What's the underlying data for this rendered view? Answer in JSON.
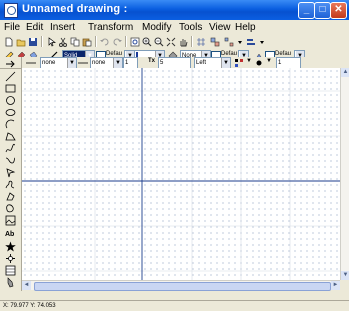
{
  "window": {
    "title": "Unnamed drawing :"
  },
  "title_buttons": {
    "minimize": "_",
    "maximize": "□",
    "close": "✕"
  },
  "menu": [
    "File",
    "Edit",
    "Insert",
    "Transform",
    "Modify",
    "Tools",
    "View",
    "Help"
  ],
  "toolbar2": {
    "line_style_value": "Solid",
    "checkbox1_label": "Defau",
    "checkbox2_label": "Defau",
    "fill_value": "None",
    "checkbox3_label": "Defau",
    "checkbox4_label": "Defau"
  },
  "toolbar3": {
    "arrow_start_value": "none",
    "arrow_end_value": "none",
    "width_value": "1",
    "font_size_value": "5",
    "align_value": "Left",
    "marker_value": "1"
  },
  "status": {
    "coords": "X: 79.977 Y: 74.053"
  },
  "scroll": {
    "up": "▲",
    "down": "▼",
    "left": "◄",
    "right": "►"
  },
  "icons": {
    "palette": [
      "select-arrow-icon",
      "line-tool-icon",
      "rectangle-tool-icon",
      "circle-tool-icon",
      "ellipse-tool-icon",
      "arc-tool-icon",
      "polygon-tool-icon",
      "freehand-tool-icon",
      "curve-tool-icon",
      "star-tool-icon",
      "spiral-tool-icon",
      "polyline-tool-icon",
      "closed-curve-tool-icon",
      "image-tool-icon",
      "text-tool-icon",
      "symbol-tool-icon",
      "node-edit-icon",
      "table-tool-icon",
      "paint-bucket-icon"
    ]
  },
  "colors": {
    "titlebar": "#0a5ee0",
    "guide_line": "#1c3d8c",
    "grid_dot": "#b8c4d8"
  }
}
